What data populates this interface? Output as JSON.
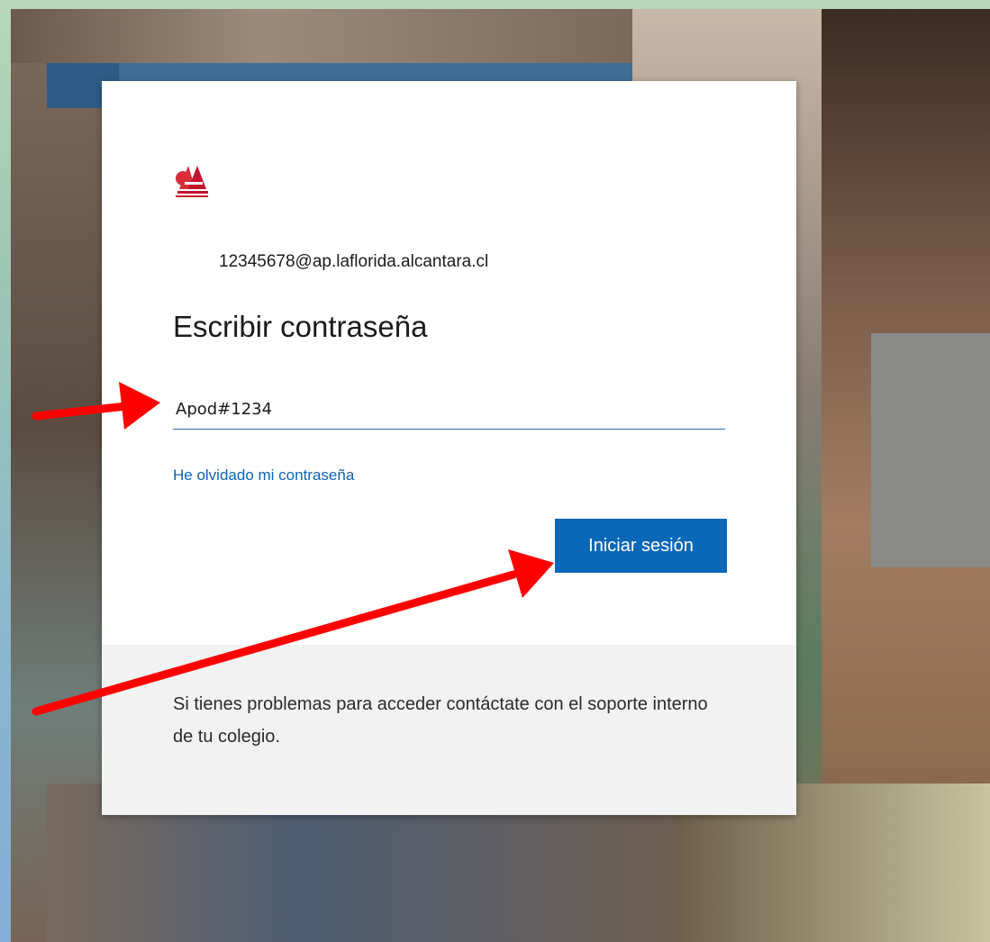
{
  "login": {
    "email": "12345678@ap.laflorida.alcantara.cl",
    "title": "Escribir contraseña",
    "password_value": "Apod#1234",
    "forgot_link": "He olvidado mi contraseña",
    "signin_button": "Iniciar sesión",
    "help_text": "Si tienes problemas para acceder contáctate con el soporte interno de tu colegio.",
    "logo_icon": "school-logo-icon"
  },
  "annotations": {
    "arrow_color": "#ff0000"
  },
  "colors": {
    "accent": "#0b67b7",
    "link": "#0b63b6",
    "input_underline": "#2d6fb2",
    "frame_green": "#b9d7b9"
  }
}
